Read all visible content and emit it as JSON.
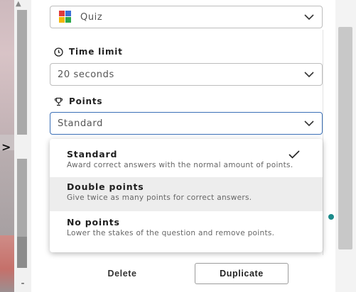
{
  "question_type": {
    "value": "Quiz",
    "icon": "quiz-grid-icon"
  },
  "time_limit": {
    "label": "Time limit",
    "icon": "clock-icon",
    "value": "20 seconds"
  },
  "points": {
    "label": "Points",
    "icon": "trophy-icon",
    "value": "Standard",
    "options": [
      {
        "title": "Standard",
        "description": "Award correct answers with the normal amount of points.",
        "selected": true
      },
      {
        "title": "Double points",
        "description": "Give twice as many points for correct answers.",
        "selected": false
      },
      {
        "title": "No points",
        "description": "Lower the stakes of the question and remove points.",
        "selected": false
      }
    ]
  },
  "footer": {
    "delete_label": "Delete",
    "duplicate_label": "Duplicate"
  },
  "sidebar": {
    "expand_glyph": ">",
    "collapse_glyph": "-"
  },
  "colors": {
    "accent_border": "#3b6fb6",
    "hover_bg": "#ededed",
    "teal": "#1b8a8a"
  }
}
